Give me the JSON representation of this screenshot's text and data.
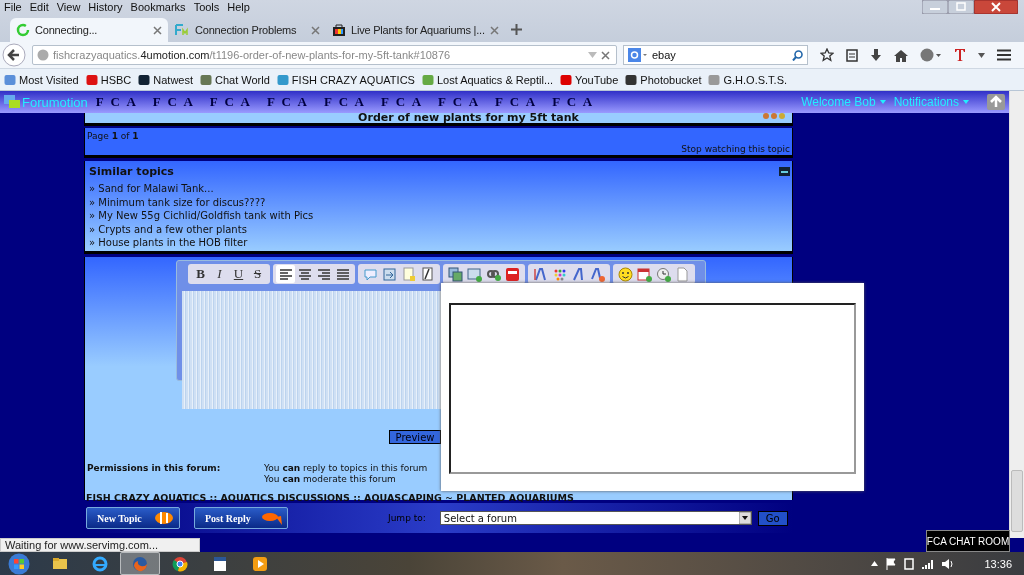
{
  "menu": [
    "File",
    "Edit",
    "View",
    "History",
    "Bookmarks",
    "Tools",
    "Help"
  ],
  "tabs": [
    {
      "label": "Connecting...",
      "selected": true,
      "kind": "loading"
    },
    {
      "label": "Connection Problems",
      "selected": false,
      "kind": "site"
    },
    {
      "label": "Live Plants for Aquariums |...",
      "selected": false,
      "kind": "shop"
    }
  ],
  "address": {
    "url": "fishcrazyaquatics.**4umotion.com**/t1196-order-of-new-plants-for-my-5ft-tank#10876"
  },
  "search": {
    "value": "ebay"
  },
  "bookmarks": [
    "Most Visited",
    "HSBC",
    "Natwest",
    "Chat World",
    "FISH CRAZY AQUATICS",
    "Lost Aquatics & Reptil...",
    "YouTube",
    "Photobucket",
    "G.H.O.S.T.S."
  ],
  "forum_header": {
    "logo": "Forumotion",
    "banner": "F C A   F C A   F C A   F C A   F C A   F C A   F C A   F C A   F C A",
    "user_menu": "Welcome Bob",
    "notifications": "Notifications"
  },
  "topic": {
    "title": "Order of new plants for my 5ft tank",
    "pagination": "Page **1** of **1**",
    "watch_link": "Stop watching this topic"
  },
  "similar_topics": {
    "title": "Similar topics",
    "items": [
      "» Sand for Malawi Tank...",
      "» Minimum tank size for discus????",
      "» My New 55g Cichlid/Goldfish tank with Pics",
      "» Crypts and a few other plants",
      "» House plants in the HOB filter"
    ]
  },
  "editor": {
    "format_buttons": [
      "B",
      "I",
      "U",
      "S"
    ],
    "align_buttons": [
      {
        "selected": true
      },
      {
        "selected": false
      },
      {
        "selected": false
      },
      {
        "selected": false
      }
    ],
    "preview_button": "Preview"
  },
  "permissions": {
    "label": "Permissions in this forum:",
    "lines": [
      "You **can** reply to topics in this forum",
      "You **can** moderate this forum"
    ]
  },
  "breadcrumb": "FISH CRAZY AQUATICS :: AQUATICS DISCUSSIONS :: AQUASCAPING ~ PLANTED AQUARIUMS",
  "actions": [
    "New Topic",
    "Post Reply"
  ],
  "jump": {
    "label": "Jump to:",
    "value": "Select a forum",
    "button": "Go"
  },
  "status_bar": "Waiting for www.servimg.com...",
  "chat_room": "FCA CHAT ROOM",
  "taskbar": {
    "apps": [
      {
        "kind": "folder",
        "selected": false
      },
      {
        "kind": "ie",
        "selected": false
      },
      {
        "kind": "firefox",
        "selected": true
      },
      {
        "kind": "chrome",
        "selected": false
      },
      {
        "kind": "word",
        "selected": false
      },
      {
        "kind": "media",
        "selected": false
      }
    ],
    "clock": "13:36"
  }
}
